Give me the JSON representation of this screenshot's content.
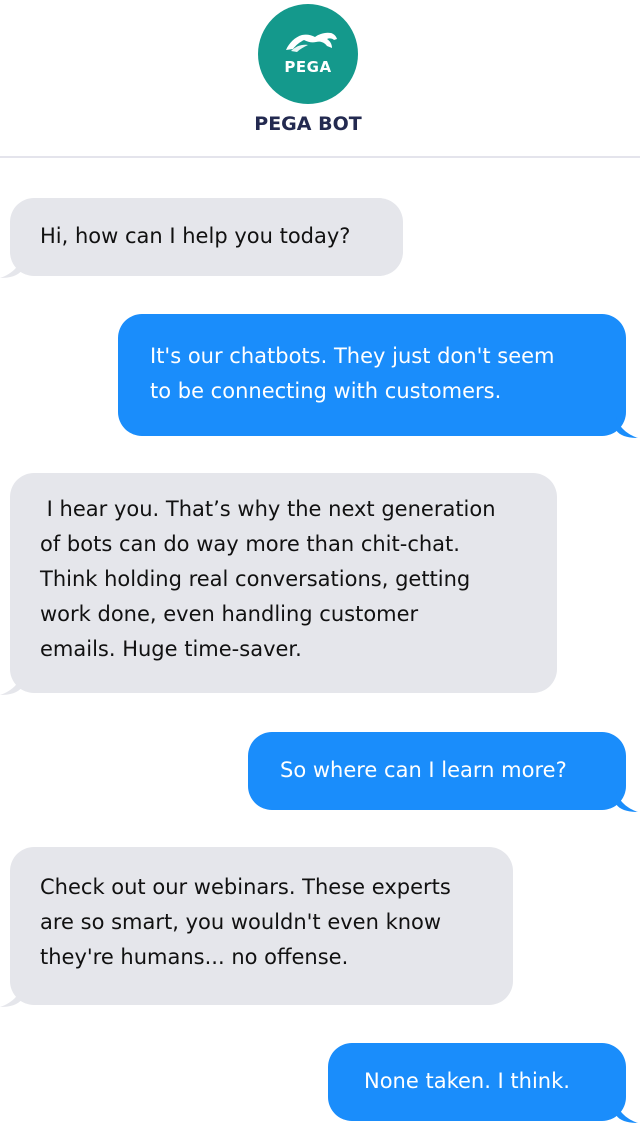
{
  "header": {
    "logo_text": "PEGA",
    "bot_name": "PEGA BOT"
  },
  "messages": [
    {
      "from": "bot",
      "lines": [
        "Hi, how can I help you today?"
      ]
    },
    {
      "from": "user",
      "lines": [
        "It's our chatbots. They just don't seem",
        "to be connecting with customers."
      ]
    },
    {
      "from": "bot",
      "lines": [
        " I hear you. That’s why the next generation",
        "of bots can do way more than chit-chat.",
        "Think holding real conversations, getting",
        "work done, even handling customer",
        "emails. Huge time-saver."
      ]
    },
    {
      "from": "user",
      "lines": [
        "So where can I learn more?"
      ]
    },
    {
      "from": "bot",
      "lines": [
        "Check out our webinars. These experts",
        "are so smart, you wouldn't even know",
        "they're humans... no offense."
      ]
    },
    {
      "from": "user",
      "lines": [
        "None taken. I think."
      ]
    }
  ],
  "colors": {
    "brand_teal": "#14998c",
    "bot_name": "#232a50",
    "bubble_in": "#e5e6eb",
    "bubble_out": "#1a8dfb"
  }
}
